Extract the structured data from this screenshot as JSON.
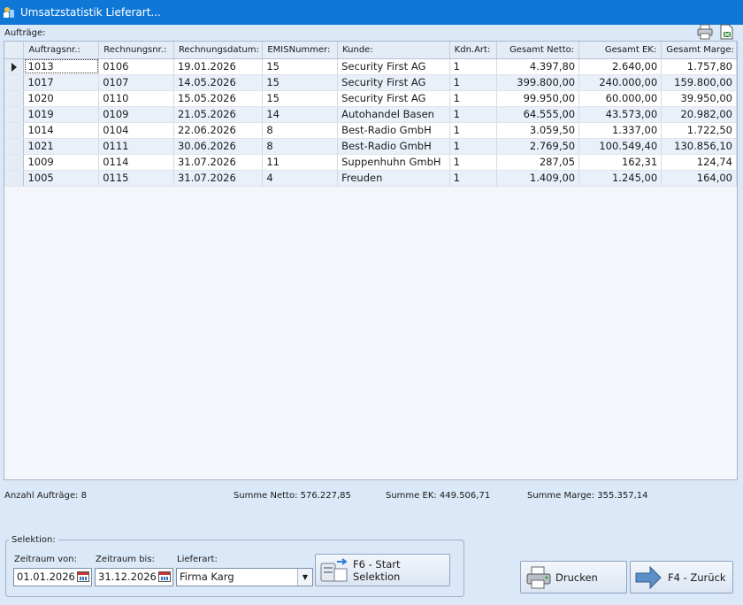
{
  "window": {
    "title": "Umsatzstatistik Lieferart..."
  },
  "section_label": "Aufträge:",
  "toolbar": {
    "print_icon": "printer-icon",
    "export_icon": "excel-export-icon"
  },
  "grid": {
    "columns": [
      "Auftragsnr.:",
      "Rechnungsnr.:",
      "Rechnungsdatum:",
      "EMISNummer:",
      "Kunde:",
      "Kdn.Art:",
      "Gesamt Netto:",
      "Gesamt EK:",
      "Gesamt Marge:"
    ],
    "rows": [
      [
        "1013",
        "0106",
        "19.01.2026",
        "15",
        "Security First AG",
        "1",
        "4.397,80",
        "2.640,00",
        "1.757,80"
      ],
      [
        "1017",
        "0107",
        "14.05.2026",
        "15",
        "Security First AG",
        "1",
        "399.800,00",
        "240.000,00",
        "159.800,00"
      ],
      [
        "1020",
        "0110",
        "15.05.2026",
        "15",
        "Security First AG",
        "1",
        "99.950,00",
        "60.000,00",
        "39.950,00"
      ],
      [
        "1019",
        "0109",
        "21.05.2026",
        "14",
        "Autohandel Basen",
        "1",
        "64.555,00",
        "43.573,00",
        "20.982,00"
      ],
      [
        "1014",
        "0104",
        "22.06.2026",
        "8",
        "Best-Radio GmbH",
        "1",
        "3.059,50",
        "1.337,00",
        "1.722,50"
      ],
      [
        "1021",
        "0111",
        "30.06.2026",
        "8",
        "Best-Radio GmbH",
        "1",
        "2.769,50",
        "100.549,40",
        "130.856,10"
      ],
      [
        "1009",
        "0114",
        "31.07.2026",
        "11",
        "Suppenhuhn GmbH",
        "1",
        "287,05",
        "162,31",
        "124,74"
      ],
      [
        "1005",
        "0115",
        "31.07.2026",
        "4",
        "Freuden",
        "1",
        "1.409,00",
        "1.245,00",
        "164,00"
      ]
    ]
  },
  "summary": {
    "count": "Anzahl Aufträge: 8",
    "netto": "Summe Netto: 576.227,85",
    "ek": "Summe EK: 449.506,71",
    "marge": "Summe Marge: 355.357,14"
  },
  "selection": {
    "legend": "Selektion:",
    "from_label": "Zeitraum von:",
    "from_value": "01.01.2026",
    "to_label": "Zeitraum bis:",
    "to_value": "31.12.2026",
    "type_label": "Lieferart:",
    "type_value": "Firma Karg",
    "start_button": "F6 - Start Selektion"
  },
  "buttons": {
    "print": "Drucken",
    "back": "F4 - Zurück"
  },
  "colors": {
    "titlebar": "#0f78d7",
    "background": "#dbe8f7",
    "row_alt": "#e9f0f9"
  }
}
